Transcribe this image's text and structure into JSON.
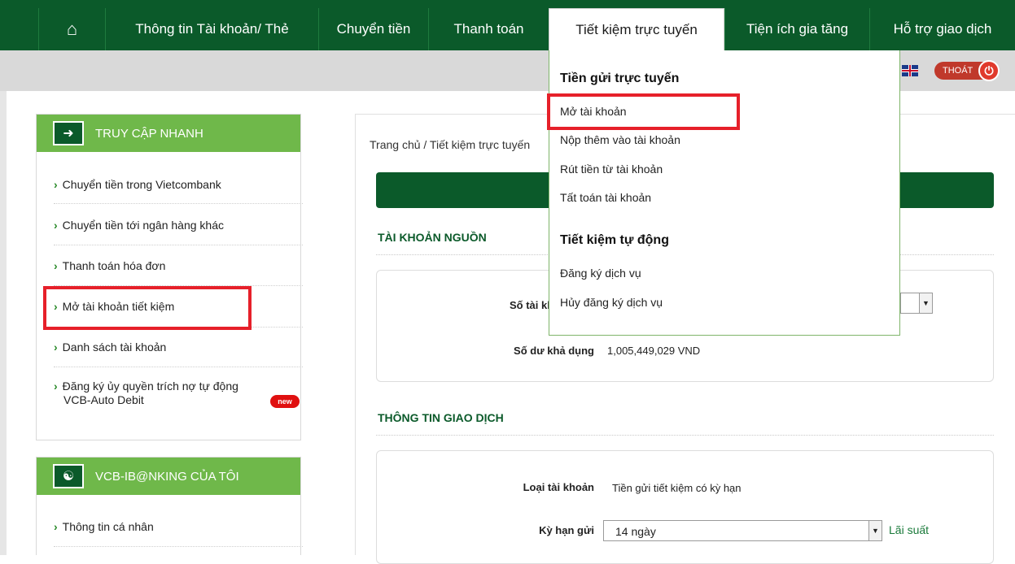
{
  "nav": {
    "items": [
      "Thông tin Tài khoản/ Thẻ",
      "Chuyển tiền",
      "Thanh toán",
      "Tiết kiệm trực tuyến",
      "Tiện ích gia tăng",
      "Hỗ trợ giao dịch"
    ]
  },
  "header": {
    "logout_label": "THOÁT"
  },
  "sidebar": {
    "quick_access": {
      "title": "TRUY CẬP NHANH",
      "items": [
        "Chuyển tiền trong Vietcombank",
        "Chuyển tiền tới ngân hàng khác",
        "Thanh toán hóa đơn",
        "Mở tài khoản tiết kiệm",
        "Danh sách tài khoản",
        "Đăng ký ủy quyền trích nợ tự động",
        "VCB-Auto Debit"
      ],
      "new_badge": "new"
    },
    "my_banking": {
      "title": "VCB-IB@NKING CỦA TÔI",
      "items": [
        "Thông tin cá nhân"
      ]
    }
  },
  "main": {
    "breadcrumb": "Trang chủ / Tiết kiệm trực tuyến",
    "source_account": {
      "title": "TÀI KHOẢN NGUỒN",
      "account_label": "Số tài khoản",
      "balance_label": "Số dư khả dụng",
      "balance_value": "1,005,449,029 VND"
    },
    "transaction": {
      "title": "THÔNG TIN GIAO DỊCH",
      "type_label": "Loại tài khoản",
      "type_value": "Tiền gửi tiết kiệm có kỳ hạn",
      "term_label": "Kỳ hạn gửi",
      "term_value": "14 ngày",
      "rate_link": "Lãi suất"
    }
  },
  "dropdown": {
    "online_deposit": {
      "title": "Tiền gửi trực tuyến",
      "items": [
        "Mở tài khoản",
        "Nộp thêm vào tài khoản",
        "Rút tiền từ tài khoản",
        "Tất toán tài khoản"
      ]
    },
    "auto_saving": {
      "title": "Tiết kiệm tự động",
      "items": [
        "Đăng ký dịch vụ",
        "Hủy đăng ký dịch vụ"
      ]
    }
  },
  "colors": {
    "brand_dark": "#0b5a2a",
    "brand_light": "#6fb84a",
    "highlight": "#e6202a"
  }
}
